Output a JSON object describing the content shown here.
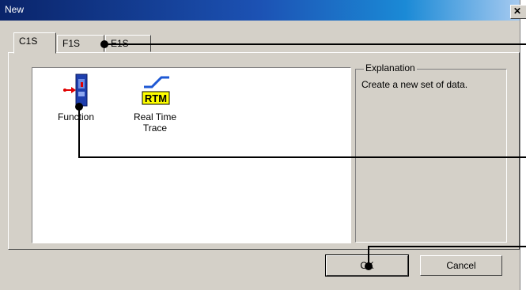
{
  "window": {
    "title": "New",
    "close_glyph": "✕"
  },
  "tabs": [
    {
      "label": "C1S",
      "active": true
    },
    {
      "label": "F1S",
      "active": false
    },
    {
      "label": "E1S",
      "active": false
    }
  ],
  "items": [
    {
      "label": "Function",
      "icon": "function-module-icon"
    },
    {
      "label_line1": "Real Time",
      "label_line2": "Trace",
      "icon_text": "RTM",
      "icon": "rtm-icon"
    }
  ],
  "explanation": {
    "legend": "Explanation",
    "text": "Create a new set of data."
  },
  "buttons": {
    "ok": "OK",
    "cancel": "Cancel"
  },
  "colors": {
    "title_start": "#0a246a",
    "title_end": "#a6caf0",
    "rtm_yellow": "#ffff00",
    "module_blue": "#1e3fae",
    "arrow_red": "#e00000"
  }
}
